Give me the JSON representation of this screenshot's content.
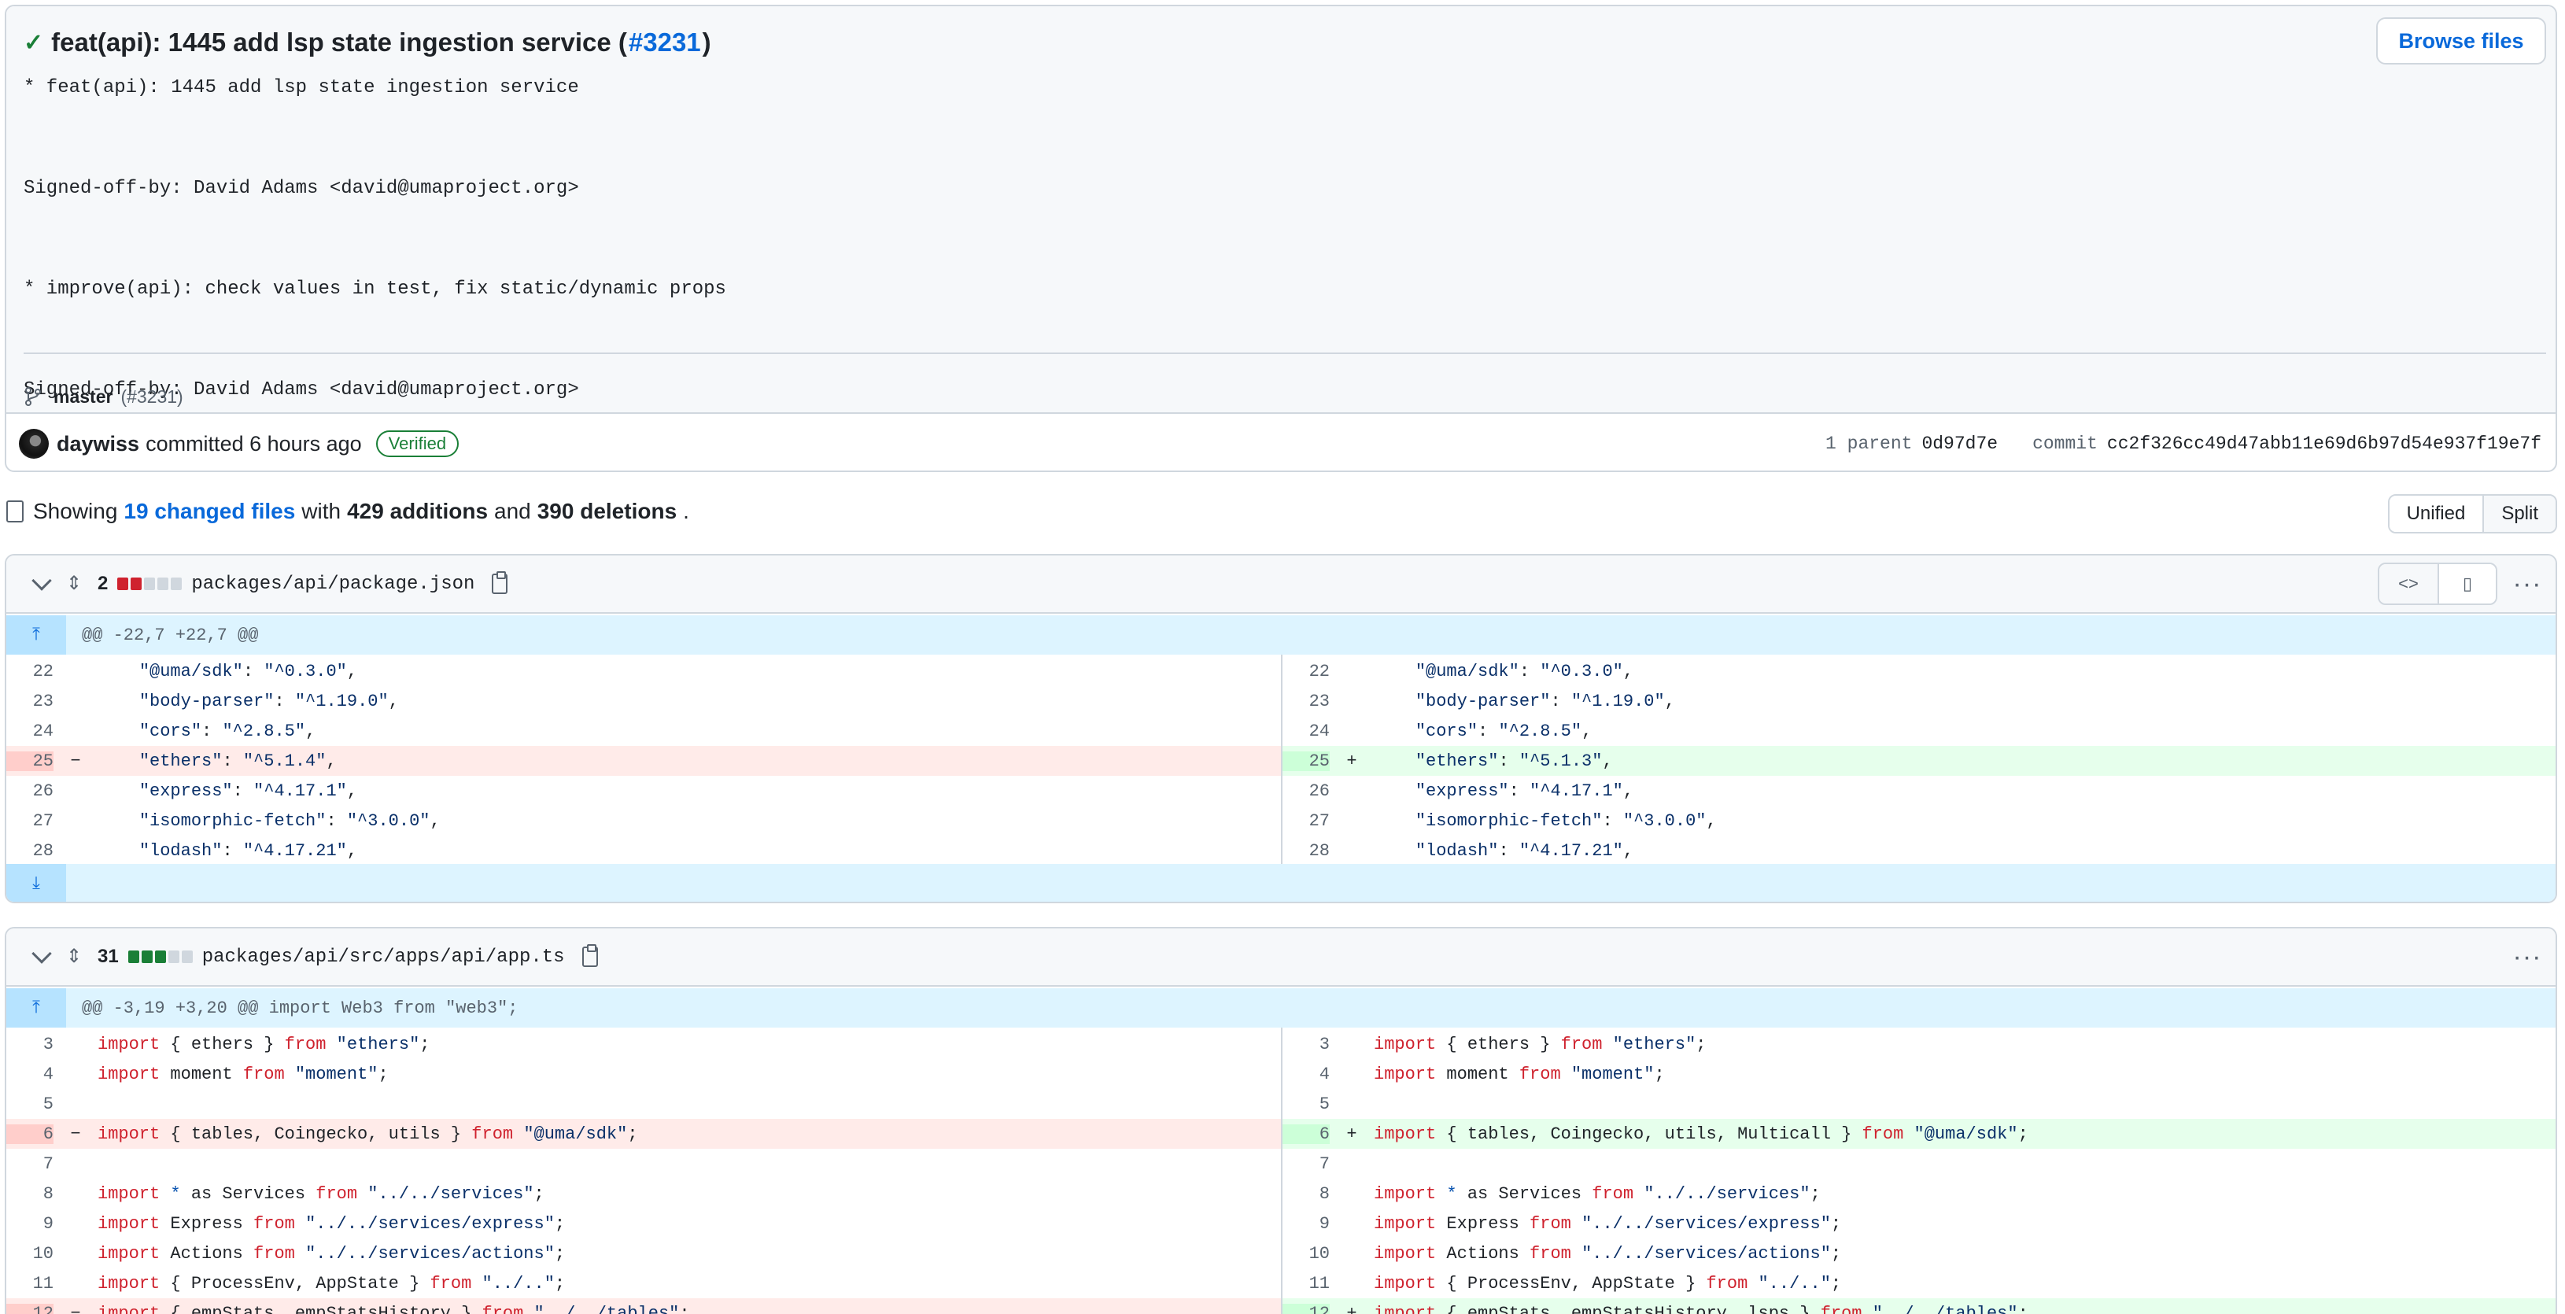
{
  "commit": {
    "check_icon": "check-icon",
    "title_prefix": "feat(api): 1445 add lsp state ingestion service (",
    "pr_link": "#3231",
    "title_suffix": ")",
    "browse_label": "Browse files",
    "message": "* feat(api): 1445 add lsp state ingestion service\n\nSigned-off-by: David Adams <david@umaproject.org>\n\n* improve(api): check values in test, fix static/dynamic props\n\nSigned-off-by: David Adams <david@umaproject.org>\n\n* improve(api): change env.multicalLAddress to MULTI_CALL_ADDRESS\n\nSigned-off-by: David Adams <david@umaproject.org>",
    "branch": "master",
    "branch_pr": "(#3231)",
    "author": "daywiss",
    "committed_text": "committed 6 hours ago",
    "verified": "Verified",
    "parent_label": "1 parent",
    "parent_sha": "0d97d7e",
    "commit_label": "commit",
    "commit_sha": "cc2f326cc49d47abb11e69d6b97d54e937f19e7f"
  },
  "summary": {
    "showing": "Showing",
    "changed_files": "19 changed files",
    "with": "with",
    "additions": "429 additions",
    "and": "and",
    "deletions": "390 deletions",
    "period": ".",
    "unified": "Unified",
    "split": "Split"
  },
  "files": [
    {
      "count": "2",
      "bars": [
        "r",
        "r",
        "n",
        "n",
        "n"
      ],
      "path": "packages/api/package.json",
      "hunk": "@@ -22,7 +22,7 @@",
      "left": [
        {
          "n": "22",
          "t": "ctx",
          "code": "    \"@uma/sdk\": \"^0.3.0\","
        },
        {
          "n": "23",
          "t": "ctx",
          "code": "    \"body-parser\": \"^1.19.0\","
        },
        {
          "n": "24",
          "t": "ctx",
          "code": "    \"cors\": \"^2.8.5\","
        },
        {
          "n": "25",
          "t": "del",
          "code": "    \"ethers\": \"^5.1.4\","
        },
        {
          "n": "26",
          "t": "ctx",
          "code": "    \"express\": \"^4.17.1\","
        },
        {
          "n": "27",
          "t": "ctx",
          "code": "    \"isomorphic-fetch\": \"^3.0.0\","
        },
        {
          "n": "28",
          "t": "ctx",
          "code": "    \"lodash\": \"^4.17.21\","
        }
      ],
      "right": [
        {
          "n": "22",
          "t": "ctx",
          "code": "    \"@uma/sdk\": \"^0.3.0\","
        },
        {
          "n": "23",
          "t": "ctx",
          "code": "    \"body-parser\": \"^1.19.0\","
        },
        {
          "n": "24",
          "t": "ctx",
          "code": "    \"cors\": \"^2.8.5\","
        },
        {
          "n": "25",
          "t": "add",
          "code": "    \"ethers\": \"^5.1.3\","
        },
        {
          "n": "26",
          "t": "ctx",
          "code": "    \"express\": \"^4.17.1\","
        },
        {
          "n": "27",
          "t": "ctx",
          "code": "    \"isomorphic-fetch\": \"^3.0.0\","
        },
        {
          "n": "28",
          "t": "ctx",
          "code": "    \"lodash\": \"^4.17.21\","
        }
      ]
    },
    {
      "count": "31",
      "bars": [
        "g",
        "g",
        "g",
        "n",
        "n"
      ],
      "path": "packages/api/src/apps/api/app.ts",
      "hunk": "@@ -3,19 +3,20 @@ import Web3 from \"web3\";",
      "left": [
        {
          "n": "3",
          "t": "ctx",
          "code": "import { ethers } from \"ethers\";"
        },
        {
          "n": "4",
          "t": "ctx",
          "code": "import moment from \"moment\";"
        },
        {
          "n": "5",
          "t": "ctx",
          "code": ""
        },
        {
          "n": "6",
          "t": "del",
          "code": "import { tables, Coingecko, utils } from \"@uma/sdk\";"
        },
        {
          "n": "7",
          "t": "ctx",
          "code": ""
        },
        {
          "n": "8",
          "t": "ctx",
          "code": "import * as Services from \"../../services\";"
        },
        {
          "n": "9",
          "t": "ctx",
          "code": "import Express from \"../../services/express\";"
        },
        {
          "n": "10",
          "t": "ctx",
          "code": "import Actions from \"../../services/actions\";"
        },
        {
          "n": "11",
          "t": "ctx",
          "code": "import { ProcessEnv, AppState } from \"../..\";"
        },
        {
          "n": "12",
          "t": "del",
          "code": "import { empStats, empStatsHistory } from \"../../tables\";"
        }
      ],
      "right": [
        {
          "n": "3",
          "t": "ctx",
          "code": "import { ethers } from \"ethers\";"
        },
        {
          "n": "4",
          "t": "ctx",
          "code": "import moment from \"moment\";"
        },
        {
          "n": "5",
          "t": "ctx",
          "code": ""
        },
        {
          "n": "6",
          "t": "add",
          "code": "import { tables, Coingecko, utils, Multicall } from \"@uma/sdk\";"
        },
        {
          "n": "7",
          "t": "ctx",
          "code": ""
        },
        {
          "n": "8",
          "t": "ctx",
          "code": "import * as Services from \"../../services\";"
        },
        {
          "n": "9",
          "t": "ctx",
          "code": "import Express from \"../../services/express\";"
        },
        {
          "n": "10",
          "t": "ctx",
          "code": "import Actions from \"../../services/actions\";"
        },
        {
          "n": "11",
          "t": "ctx",
          "code": "import { ProcessEnv, AppState } from \"../..\";"
        },
        {
          "n": "12",
          "t": "add",
          "code": "import { empStats, empStatsHistory, lsps } from \"../../tables\";"
        }
      ]
    }
  ]
}
